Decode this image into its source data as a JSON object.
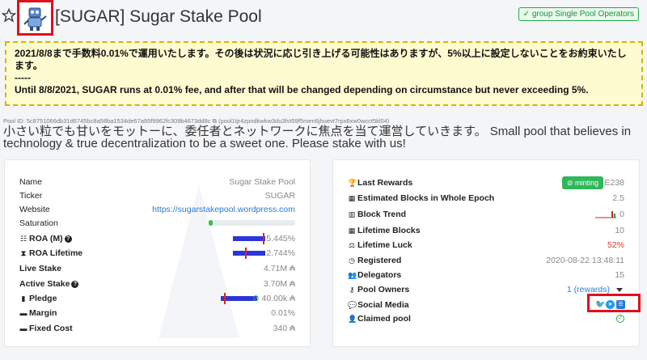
{
  "header": {
    "title": "[SUGAR] Sugar Stake Pool",
    "group_badge": "✓ group Single Pool Operators"
  },
  "notice": {
    "jp": "2021/8/8まで手数料0.01%で運用いたします。その後は状況に応じ引き上げる可能性はありますが、5%以上に設定しないことをお約束いたします。",
    "separator": "-----",
    "en": "Until 8/8/2021, SUGAR runs at 0.01% fee, and after that will be changed depending on circumstance but never exceeding 5%."
  },
  "pool_id_line": "Pool ID: 5c8751066db31d6745bc8a58ba1534de67a95f9962fc309b4673dd8c ⧉ (pool1tjr4zpndkwkw3du3fvt59f5men6jhuevt7rpx6xw0wcct5kl04)",
  "description": "小さい粒でも甘いをモットーに、委任者とネットワークに焦点を当て運営していきます。 Small pool that believes in technology & true decentralization to be a sweet one. Please stake with us!",
  "left_card": {
    "name_label": "Name",
    "name_value": "Sugar Stake Pool",
    "ticker_label": "Ticker",
    "ticker_value": "SUGAR",
    "website_label": "Website",
    "website_value": "https://sugarstakepool.wordpress.com",
    "saturation_label": "Saturation",
    "saturation_fraction": 0.05,
    "roa_m_label": "ROA (M)",
    "roa_m_value": "5.445%",
    "roa_lifetime_label": "ROA Lifetime",
    "roa_lifetime_value": "2.744%",
    "live_stake_label": "Live Stake",
    "live_stake_value": "4.71M ₳",
    "active_stake_label": "Active Stake",
    "active_stake_value": "3.70M ₳",
    "pledge_label": "Pledge",
    "pledge_value": "40.00k ₳",
    "margin_label": "Margin",
    "margin_value": "0.01%",
    "fixed_cost_label": "Fixed Cost",
    "fixed_cost_value": "340 ₳"
  },
  "right_card": {
    "last_rewards_label": "Last Rewards",
    "minting_badge": "⊘ minting",
    "epoch_value": "E238",
    "est_blocks_label": "Estimated Blocks in Whole Epoch",
    "est_blocks_value": "2.5",
    "block_trend_label": "Block Trend",
    "block_trend_value": "0",
    "lifetime_blocks_label": "Lifetime Blocks",
    "lifetime_blocks_value": "10",
    "lifetime_luck_label": "Lifetime Luck",
    "lifetime_luck_value": "52%",
    "registered_label": "Registered",
    "registered_value": "2020-08-22 13:48:11",
    "delegators_label": "Delegators",
    "delegators_value": "15",
    "pool_owners_label": "Pool Owners",
    "pool_owners_value": "1 (rewards)",
    "social_media_label": "Social Media",
    "claimed_pool_label": "Claimed pool"
  },
  "colors": {
    "accent": "#2a7bd4",
    "positive": "#28a745",
    "highlight_box": "#e0101a",
    "notice_bg": "#fffbd0"
  },
  "icons": [
    "star-icon",
    "pool-logo-icon",
    "trophy-icon",
    "grid-icon",
    "bar-chart-icon",
    "blocks-icon",
    "luck-icon",
    "clock-icon",
    "users-icon",
    "key-icon",
    "comment-icon",
    "user-icon",
    "twitter-icon",
    "telegram-icon",
    "list-icon"
  ]
}
